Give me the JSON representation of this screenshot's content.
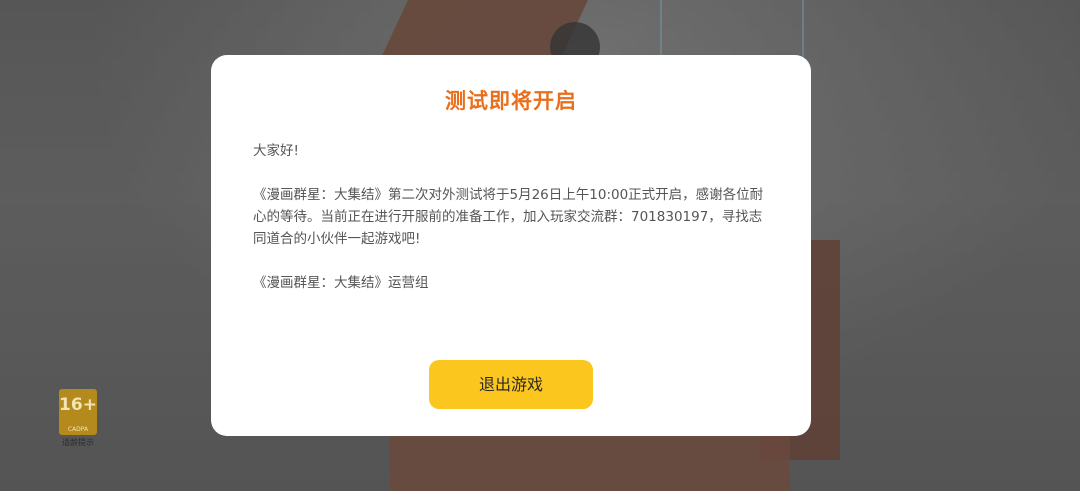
{
  "age_rating": {
    "number": "16+",
    "org": "CADPA",
    "caption": "适龄提示"
  },
  "dialog": {
    "title": "测试即将开启",
    "greeting": "大家好!",
    "message": "《漫画群星：大集结》第二次对外测试将于5月26日上午10:00正式开启，感谢各位耐心的等待。当前正在进行开服前的准备工作，加入玩家交流群：701830197，寻找志同道合的小伙伴一起游戏吧!",
    "signature": "《漫画群星：大集结》运营组",
    "exit_button_label": "退出游戏"
  },
  "colors": {
    "title": "#ea6f1c",
    "button": "#fbc61d",
    "badge": "#b58a1c"
  }
}
